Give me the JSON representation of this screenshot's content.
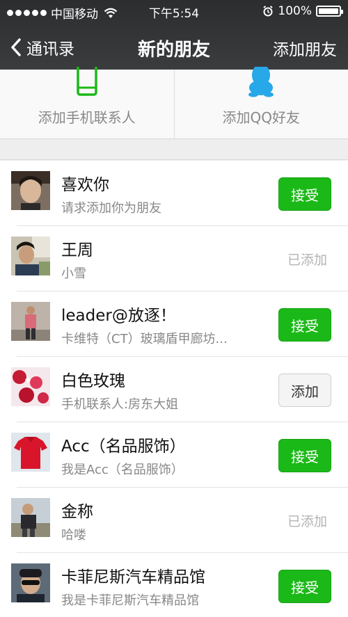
{
  "status_bar": {
    "carrier": "中国移动",
    "time": "下午5:54",
    "battery": "100%"
  },
  "nav": {
    "back_label": "通讯录",
    "title": "新的朋友",
    "right_action": "添加朋友"
  },
  "options": [
    {
      "label": "添加手机联系人",
      "icon": "phone-icon",
      "color": "#1bb918"
    },
    {
      "label": "添加QQ好友",
      "icon": "qq-penguin-icon",
      "color": "#27a8e8"
    }
  ],
  "requests": [
    {
      "name": "喜欢你",
      "message": "请求添加你为朋友",
      "action": "接受",
      "action_type": "accept"
    },
    {
      "name": "王周",
      "message": "小雪",
      "action": "已添加",
      "action_type": "added"
    },
    {
      "name": "leader@放逐！",
      "message": "卡维特（CT）玻璃盾甲廊坊...",
      "action": "接受",
      "action_type": "accept"
    },
    {
      "name": "白色玫瑰",
      "message": "手机联系人:房东大姐",
      "action": "添加",
      "action_type": "add"
    },
    {
      "name": "Acc（名品服饰）",
      "message": "我是Acc（名品服饰）",
      "action": "接受",
      "action_type": "accept"
    },
    {
      "name": "金称",
      "message": "哈喽",
      "action": "已添加",
      "action_type": "added"
    },
    {
      "name": "卡菲尼斯汽车精品馆",
      "message": "我是卡菲尼斯汽车精品馆",
      "action": "接受",
      "action_type": "accept"
    }
  ],
  "colors": {
    "accent_green": "#1bb918",
    "nav_bg": "#2f3133",
    "qq_blue": "#27a8e8"
  }
}
